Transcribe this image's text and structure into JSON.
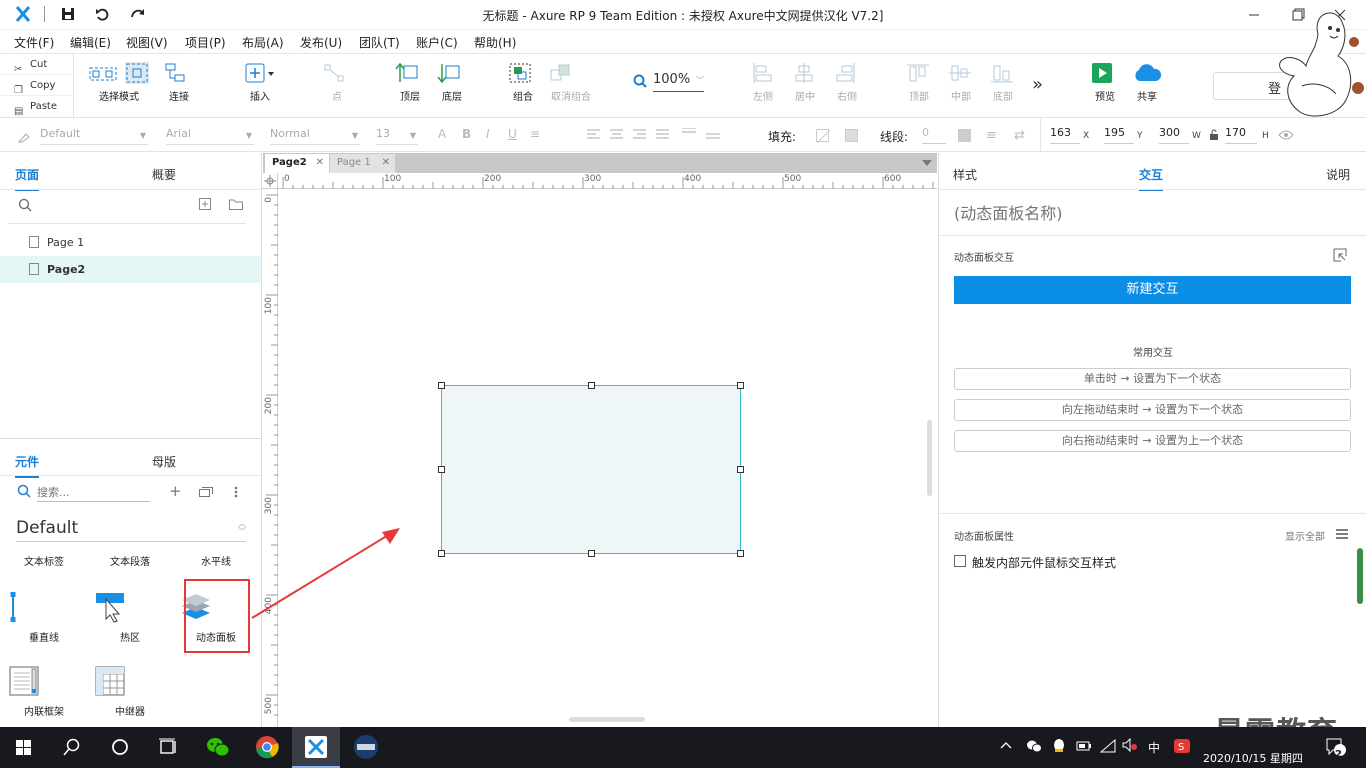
{
  "window": {
    "title": "无标题 - Axure RP 9 Team Edition : 未授权      Axure中文网提供汉化 V7.2]"
  },
  "menu": [
    "文件(F)",
    "编辑(E)",
    "视图(V)",
    "项目(P)",
    "布局(A)",
    "发布(U)",
    "团队(T)",
    "账户(C)",
    "帮助(H)"
  ],
  "clipboard": {
    "cut": "Cut",
    "copy": "Copy",
    "paste": "Paste"
  },
  "toolbar": {
    "select_mode": "选择模式",
    "connect": "连接",
    "insert": "插入",
    "point": "点",
    "top_layer": "顶层",
    "bottom_layer": "底层",
    "group": "组合",
    "ungroup": "取消组合",
    "zoom": "100%",
    "align_left": "左侧",
    "align_center": "居中",
    "align_right": "右侧",
    "align_top": "顶部",
    "align_middle": "中部",
    "align_bottom": "底部",
    "more": "»",
    "preview": "预览",
    "share": "共享",
    "login_partial": "登"
  },
  "format": {
    "style": "Default",
    "font": "Arial",
    "weight": "Normal",
    "size": "13",
    "fill_label": "填充:",
    "line_label": "线段:",
    "line_value": "0",
    "x": "163",
    "x_label": "X",
    "y": "195",
    "y_label": "Y",
    "w": "300",
    "w_label": "W",
    "h": "170",
    "h_label": "H"
  },
  "left_panel": {
    "tabs": [
      "页面",
      "概要"
    ],
    "pages": [
      "Page 1",
      "Page2"
    ],
    "lib_tabs": [
      "元件",
      "母版"
    ],
    "search_placeholder": "搜索...",
    "library": "Default",
    "widget_row0": [
      "文本标签",
      "文本段落",
      "水平线"
    ],
    "widgets": [
      "垂直线",
      "热区",
      "动态面板",
      "内联框架",
      "中继器"
    ]
  },
  "canvas": {
    "tabs": [
      "Page2",
      "Page 1"
    ],
    "ruler_h": [
      "0",
      "100",
      "200",
      "300",
      "400",
      "500",
      "600"
    ],
    "ruler_v": [
      "0",
      "100",
      "200",
      "300",
      "400",
      "500"
    ]
  },
  "right_panel": {
    "tabs": [
      "样式",
      "交互",
      "说明"
    ],
    "name_placeholder": "(动态面板名称)",
    "interactions_title": "动态面板交互",
    "new_interaction": "新建交互",
    "common_title": "常用交互",
    "common": [
      "单击时 → 设置为下一个状态",
      "向左拖动结束时 → 设置为下一个状态",
      "向右拖动结束时 → 设置为上一个状态"
    ],
    "props_title": "动态面板属性",
    "show_all": "显示全部",
    "checkbox_label": "触发内部元件鼠标交互样式"
  },
  "taskbar": {
    "ime": "中",
    "datetime": "2020/10/15 星期四",
    "notification_count": "2"
  },
  "watermark": "最需教育",
  "colors": {
    "accent": "#1a7fd4",
    "button": "#0b8ee6",
    "selection": "#32bccc",
    "annotation": "#e53935"
  }
}
